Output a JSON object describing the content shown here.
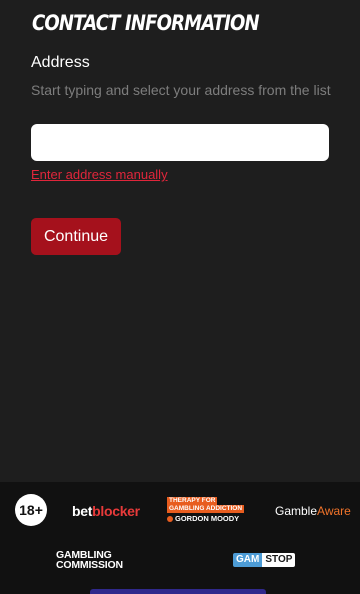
{
  "form": {
    "title": "CONTACT INFORMATION",
    "address_label": "Address",
    "address_hint": "Start typing and select your address from the list",
    "address_value": "",
    "manual_link": "Enter address manually",
    "continue_label": "Continue"
  },
  "footer": {
    "age_badge": "18+",
    "betblocker_part1": "bet",
    "betblocker_part2": "blocker",
    "therapy_line1": "THERAPY FOR",
    "therapy_line2": "GAMBLING ADDICTION",
    "therapy_line3": "GORDON MOODY",
    "gambleaware_part1": "Gamble",
    "gambleaware_part2": "Aware",
    "commission_line1": "GAMBLING",
    "commission_line2": "COMMISSION",
    "gamstop_part1": "GAM",
    "gamstop_part2": "STOP"
  },
  "colors": {
    "background": "#1e1e1e",
    "accent_red": "#a5111c",
    "link_red": "#e0263b",
    "footer_bg": "#111111"
  }
}
